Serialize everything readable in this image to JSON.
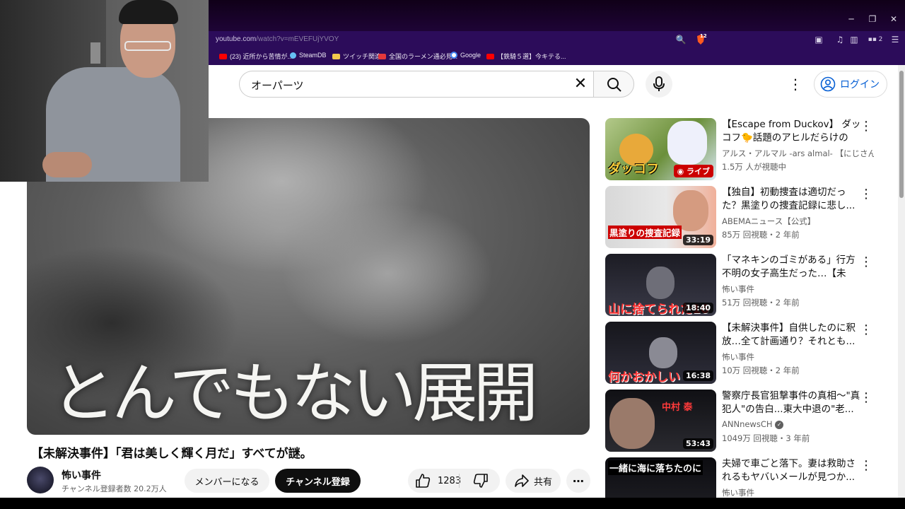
{
  "browser": {
    "url_host": "youtube.com",
    "url_path": "/watch?v=mEVEFUjYVOY",
    "extension_badge": "12",
    "panel_count": "2",
    "bookmarks": [
      {
        "label": "(23) 近所から苦情が...",
        "color": "#ff0000"
      },
      {
        "label": "SteamDB",
        "color": "#1b2838"
      },
      {
        "label": "ツイッチ関連",
        "color": "#f2c94c"
      },
      {
        "label": "全国のラーメン通必見...",
        "color": "#e5383b"
      },
      {
        "label": "Google",
        "color": "#4285f4"
      },
      {
        "label": "【鉄騎５選】今キテる...",
        "color": "#ff0000"
      }
    ]
  },
  "youtube": {
    "search_query": "オーパーツ",
    "login_label": "ログイン",
    "video": {
      "overlay_text": "とんでもない展開",
      "title": "【未解決事件】「君は美しく輝く月だ」すべてが謎。",
      "channel": "怖い事件",
      "subscribers": "チャンネル登録者数 20.2万人",
      "member_label": "メンバーになる",
      "subscribe_label": "チャンネル登録",
      "likes": "1283",
      "share_label": "共有"
    },
    "recommendations": [
      {
        "title": "【Escape from Duckov】 ダッコフ🐤話題のアヒルだらけのPV...",
        "channel": "アルス・アルマル -ars almal- 【にじさん...",
        "meta": "1.5万 人が視聴中",
        "badge": "ライブ",
        "thumb_caption": "ダッコフ",
        "thumb_colors": [
          "#b3c98a",
          "#6b8f3a"
        ]
      },
      {
        "title": "【独自】初動捜査は適切だった？黒塗りの捜査記録に悲し...",
        "channel": "ABEMAニュース【公式】",
        "meta": "85万 回視聴・2 年前",
        "badge": "33:19",
        "thumb_caption": "黒塗りの捜査記録",
        "thumb_colors": [
          "#d8d8d8",
          "#f0b09a"
        ]
      },
      {
        "title": "「マネキンのゴミがある」行方不明の女子高生だった…【未解...",
        "channel": "怖い事件",
        "meta": "51万 回視聴・2 年前",
        "badge": "18:40",
        "thumb_caption": "山に捨てられた16",
        "thumb_colors": [
          "#1c1c24",
          "#3a3a48"
        ]
      },
      {
        "title": "【未解決事件】自供したのに釈放…全て計画通り？それとも...",
        "channel": "怖い事件",
        "meta": "10万 回視聴・2 年前",
        "badge": "16:38",
        "thumb_caption": "何かおかしい",
        "thumb_colors": [
          "#16161c",
          "#2e2e3a"
        ]
      },
      {
        "title": "警察庁長官狙撃事件の真相～\"真犯人\"の告白...東大中退の\"老...",
        "channel": "ANNnewsCH",
        "meta": "1049万 回視聴・3 年前",
        "badge": "53:43",
        "thumb_caption": "中村 泰",
        "thumb_colors": [
          "#101014",
          "#2a2a30"
        ]
      },
      {
        "title": "夫婦で車ごと落下。妻は救助されるもヤバいメールが見つか...",
        "channel": "怖い事件",
        "meta": "",
        "badge": "",
        "thumb_caption": "一緒に海に落ちたのに",
        "thumb_colors": [
          "#0c0c10",
          "#222228"
        ]
      }
    ]
  }
}
